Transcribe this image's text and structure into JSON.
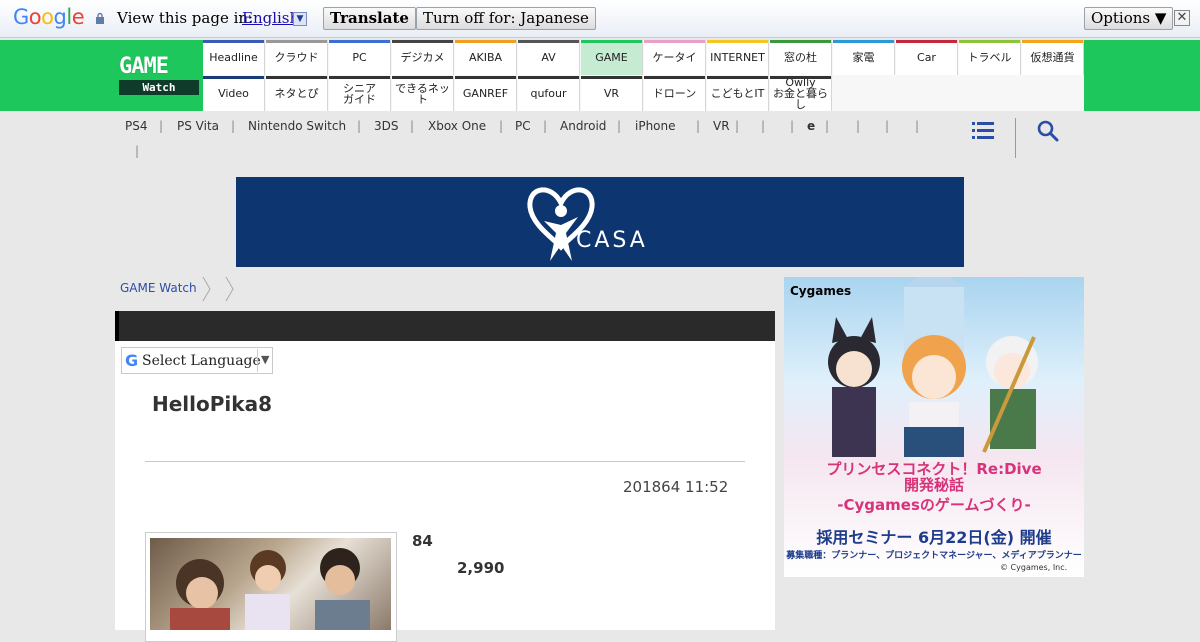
{
  "translate_bar": {
    "logo": "Google",
    "view_text": "View this page in:",
    "language": "English",
    "translate_label": "Translate",
    "turn_off_label": "Turn off for: Japanese",
    "options_label": "Options ▼",
    "close_label": "✕"
  },
  "site": {
    "logo_top": "GAME",
    "logo_bottom": "Watch"
  },
  "nav_top": [
    {
      "label": "Headline",
      "color": "#3b5bb5"
    },
    {
      "label": "クラウド",
      "color": "#999999"
    },
    {
      "label": "PC",
      "color": "#3b6fd1"
    },
    {
      "label": "デジカメ",
      "color": "#444444"
    },
    {
      "label": "AKIBA",
      "color": "#f0a020"
    },
    {
      "label": "AV",
      "color": "#555555"
    },
    {
      "label": "GAME",
      "color": "#1ec75c"
    },
    {
      "label": "ケータイ",
      "color": "#e8a0c8"
    },
    {
      "label": "INTERNET",
      "color": "#f3c623"
    },
    {
      "label": "窓の杜",
      "color": "#3a9a3a"
    },
    {
      "label": "家電",
      "color": "#2a9ad8"
    },
    {
      "label": "Car",
      "color": "#c4283c"
    },
    {
      "label": "トラベル",
      "color": "#8ec43c"
    },
    {
      "label": "仮想通貨",
      "color": "#f2a41c"
    }
  ],
  "nav_bottom": [
    {
      "label": "Video",
      "color": "#1a3c78"
    },
    {
      "label": "ネタとぴ",
      "color": "#333333"
    },
    {
      "label": "シニア\nガイド",
      "color": "#333333"
    },
    {
      "label": "できるネット",
      "color": "#333333"
    },
    {
      "label": "GANREF",
      "color": "#333333"
    },
    {
      "label": "qufour",
      "color": "#333333"
    },
    {
      "label": "VR",
      "color": "#333333"
    },
    {
      "label": "ドローン",
      "color": "#333333"
    },
    {
      "label": "こどもとIT",
      "color": "#333333"
    },
    {
      "label": "Owlly\nお金と暮らし",
      "color": "#333333"
    }
  ],
  "subnav": [
    "PS4",
    "PS Vita",
    "Nintendo Switch",
    "3DS",
    "Xbox One",
    "PC",
    "Android",
    "iPhone",
    "VR",
    "",
    "",
    "e",
    "",
    "",
    "",
    ""
  ],
  "banner": {
    "brand": "CASA"
  },
  "breadcrumb": {
    "home": "GAME Watch"
  },
  "select_language": {
    "g": "G",
    "label": "Select Language",
    "arrow": "▼"
  },
  "article": {
    "title": "HelloPika8",
    "date": "201864 11:52",
    "count": "84",
    "price": "2,990"
  },
  "side_ad": {
    "logo": "Cygames",
    "line1": "プリンセスコネクト！Re:Dive",
    "line2": "開発秘話",
    "line3": "-Cygamesのゲームづくり-",
    "line4": "採用セミナー 6月22日(金) 開催",
    "line5": "募集職種：プランナー、プロジェクトマネージャー、メディアプランナー",
    "copyright": "© Cygames, Inc."
  },
  "colors": {
    "brand_green": "#1ec75c",
    "banner_blue": "#0d3570",
    "link_blue": "#2a4ea8"
  }
}
